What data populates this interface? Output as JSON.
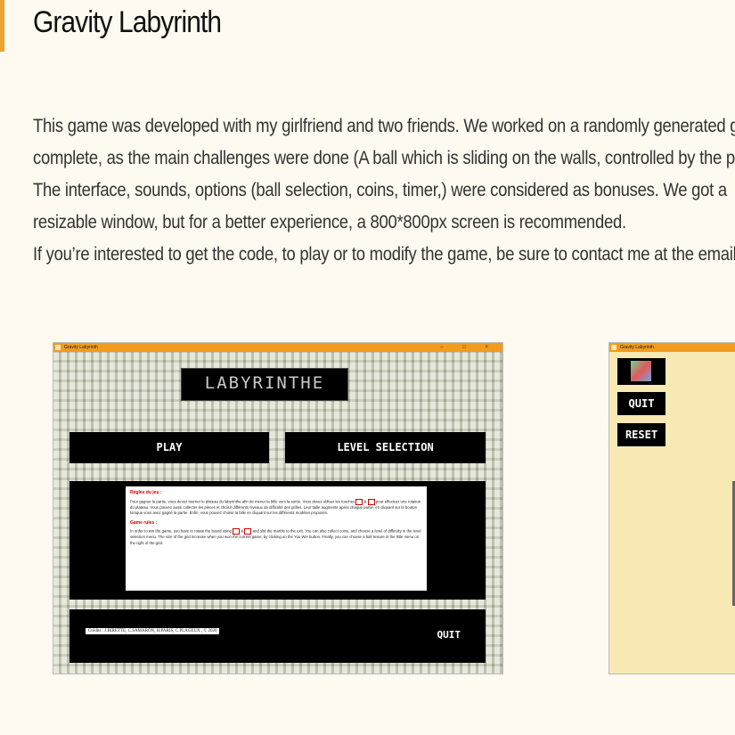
{
  "page": {
    "title": "Gravity Labyrinth",
    "description": [
      "This game was developed with my girlfriend and two friends. We worked on a randomly generated grid",
      "complete, as the main challenges were done (A ball which is sliding on the walls, controlled by the player",
      "The interface, sounds, options (ball selection, coins, timer,) were considered as bonuses. We got a",
      "resizable window, but for a better experience, a 800*800px screen is recommended.",
      "If you’re interested to get the code, to play or to modify the game, be sure to contact me at the email a"
    ]
  },
  "screenshot1": {
    "window_title": "Gravity Labyrinth",
    "window_controls": "– □ ×",
    "logo": "LABYRINTHE",
    "play_label": "PLAY",
    "level_label": "LEVEL SELECTION",
    "rules_fr_heading": "Règles du jeu :",
    "rules_fr_text_a": "Pour gagner la partie, vous devez tourner le plateau du labyrinthe afin de mener la bille vers la sortie. Vous devez utiliser les touches",
    "rules_fr_text_b": "pour effectuer une rotation du plateau. Vous pouvez aussi collecter les pièces et choisir différents niveaux de difficulté des grilles. Leur taille augmente après chaque partie, en cliquant sur le bouton lorsque vous avez gagné la partie. Enfin, vous pouvez choisir la bille en cliquant sur les différents modèles proposés.",
    "rules_en_heading": "Game rules :",
    "rules_en_text_a": "In order to win the game, you have to rotate the board using",
    "rules_en_text_b": "and slid the marble to the exit. You can also collect coins, and choose a level of difficulty in the level selection menu. The size of the grid increase when you won the current game, by clicking on the You Win button. Finally, you can choose a ball texture in the little menu on the right of the grid.",
    "key_sep": "&",
    "credits": "Crédits : J.BIRETTE, C.SAMARON, H.PARIS, C.PLAGEUX , © 2020",
    "quit_label": "QUIT"
  },
  "screenshot2": {
    "window_title": "Gravity Labyrinth",
    "quit_label": "QUIT",
    "reset_label": "RESET"
  },
  "colors": {
    "accent": "#f29b1c",
    "page_bg": "#fefaf0",
    "panel": "#000000"
  }
}
